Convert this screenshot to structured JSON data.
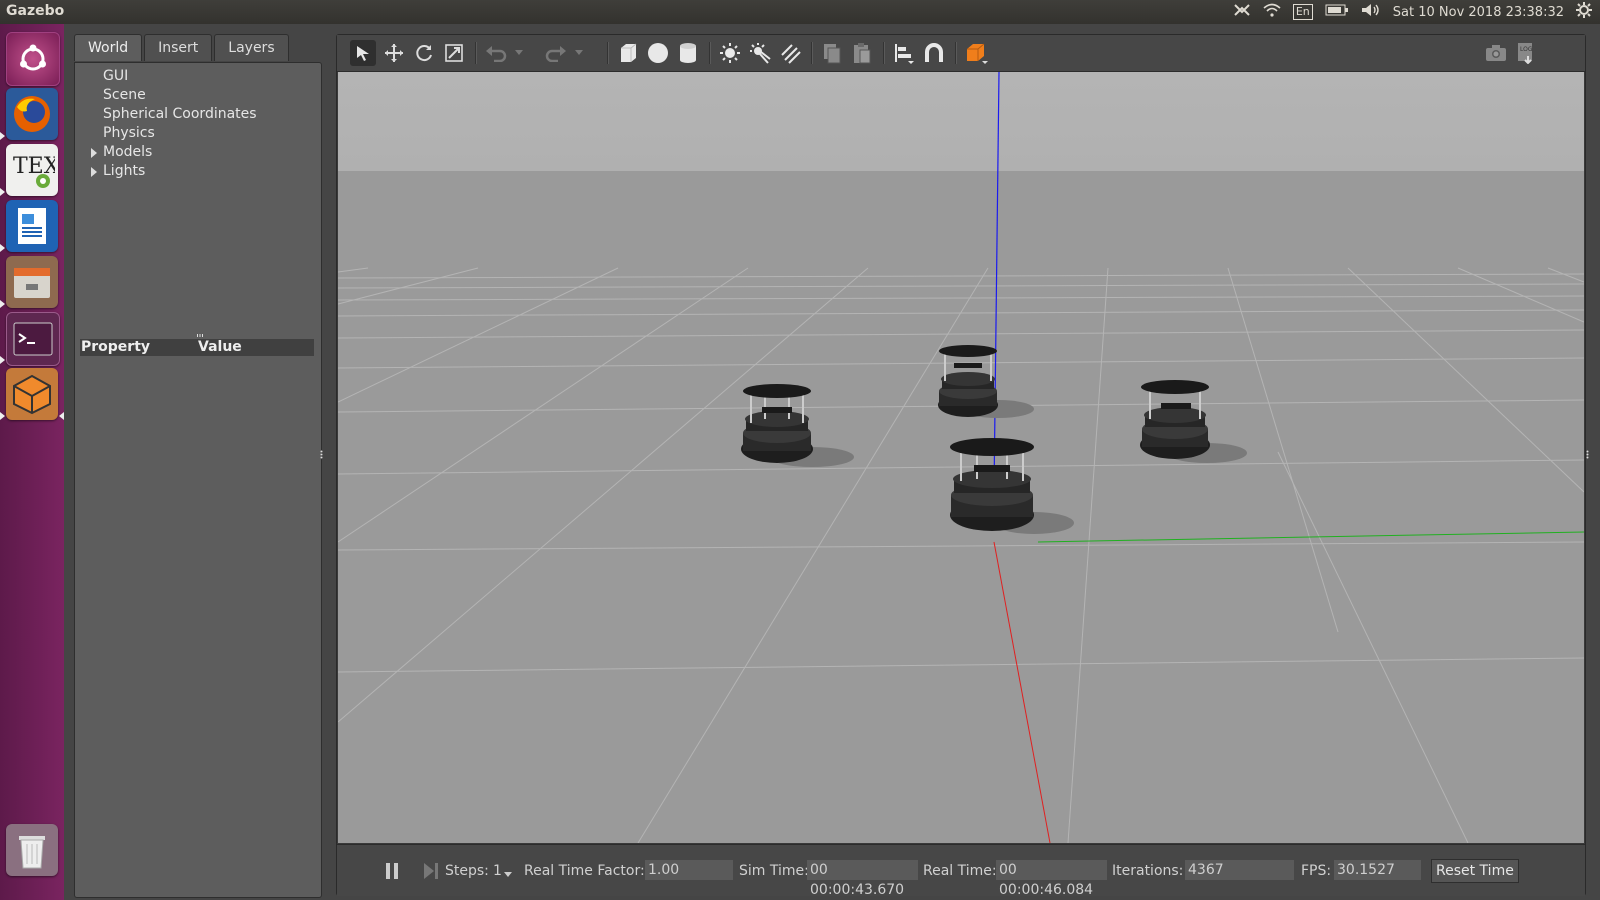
{
  "app_title": "Gazebo",
  "top_bar": {
    "keyboard_layout": "En",
    "clock": "Sat 10 Nov 2018 23:38:32"
  },
  "launcher": {
    "items": [
      {
        "name": "ubuntu-dash"
      },
      {
        "name": "firefox"
      },
      {
        "name": "texstudio"
      },
      {
        "name": "libreoffice-writer"
      },
      {
        "name": "files"
      },
      {
        "name": "terminal"
      },
      {
        "name": "gazebo"
      },
      {
        "name": "trash"
      }
    ]
  },
  "left_panel": {
    "tabs": [
      "World",
      "Insert",
      "Layers"
    ],
    "active_tab": "World",
    "tree": [
      "GUI",
      "Scene",
      "Spherical Coordinates",
      "Physics",
      "Models",
      "Lights"
    ],
    "expandable": [
      "Models",
      "Lights"
    ],
    "property_header": {
      "property": "Property",
      "value": "Value"
    }
  },
  "toolbar": {
    "icons": [
      "select-icon",
      "translate-icon",
      "rotate-icon",
      "scale-icon",
      "undo-icon",
      "redo-icon",
      "box-icon",
      "sphere-icon",
      "cylinder-icon",
      "point-light-icon",
      "spot-light-icon",
      "directional-light-icon",
      "copy-icon",
      "paste-icon",
      "align-icon",
      "snap-icon",
      "view-angle-icon",
      "screenshot-icon",
      "log-icon"
    ]
  },
  "bottom_bar": {
    "steps_label": "Steps:",
    "steps_value": "1",
    "rtf_label": "Real Time Factor:",
    "rtf_value": "1.00",
    "sim_time_label": "Sim Time:",
    "sim_time_value": "00 00:00:43.670",
    "real_time_label": "Real Time:",
    "real_time_value": "00 00:00:46.084",
    "iterations_label": "Iterations:",
    "iterations_value": "4367",
    "fps_label": "FPS:",
    "fps_value": "30.1527",
    "reset_label": "Reset Time"
  },
  "colors": {
    "launcher_bg": "#6b1f56",
    "axis_x": "#ff0000",
    "axis_y": "#00ff00",
    "axis_z": "#0000ff",
    "ground": "#9a9a9a",
    "sky": "#b3b3b3"
  }
}
